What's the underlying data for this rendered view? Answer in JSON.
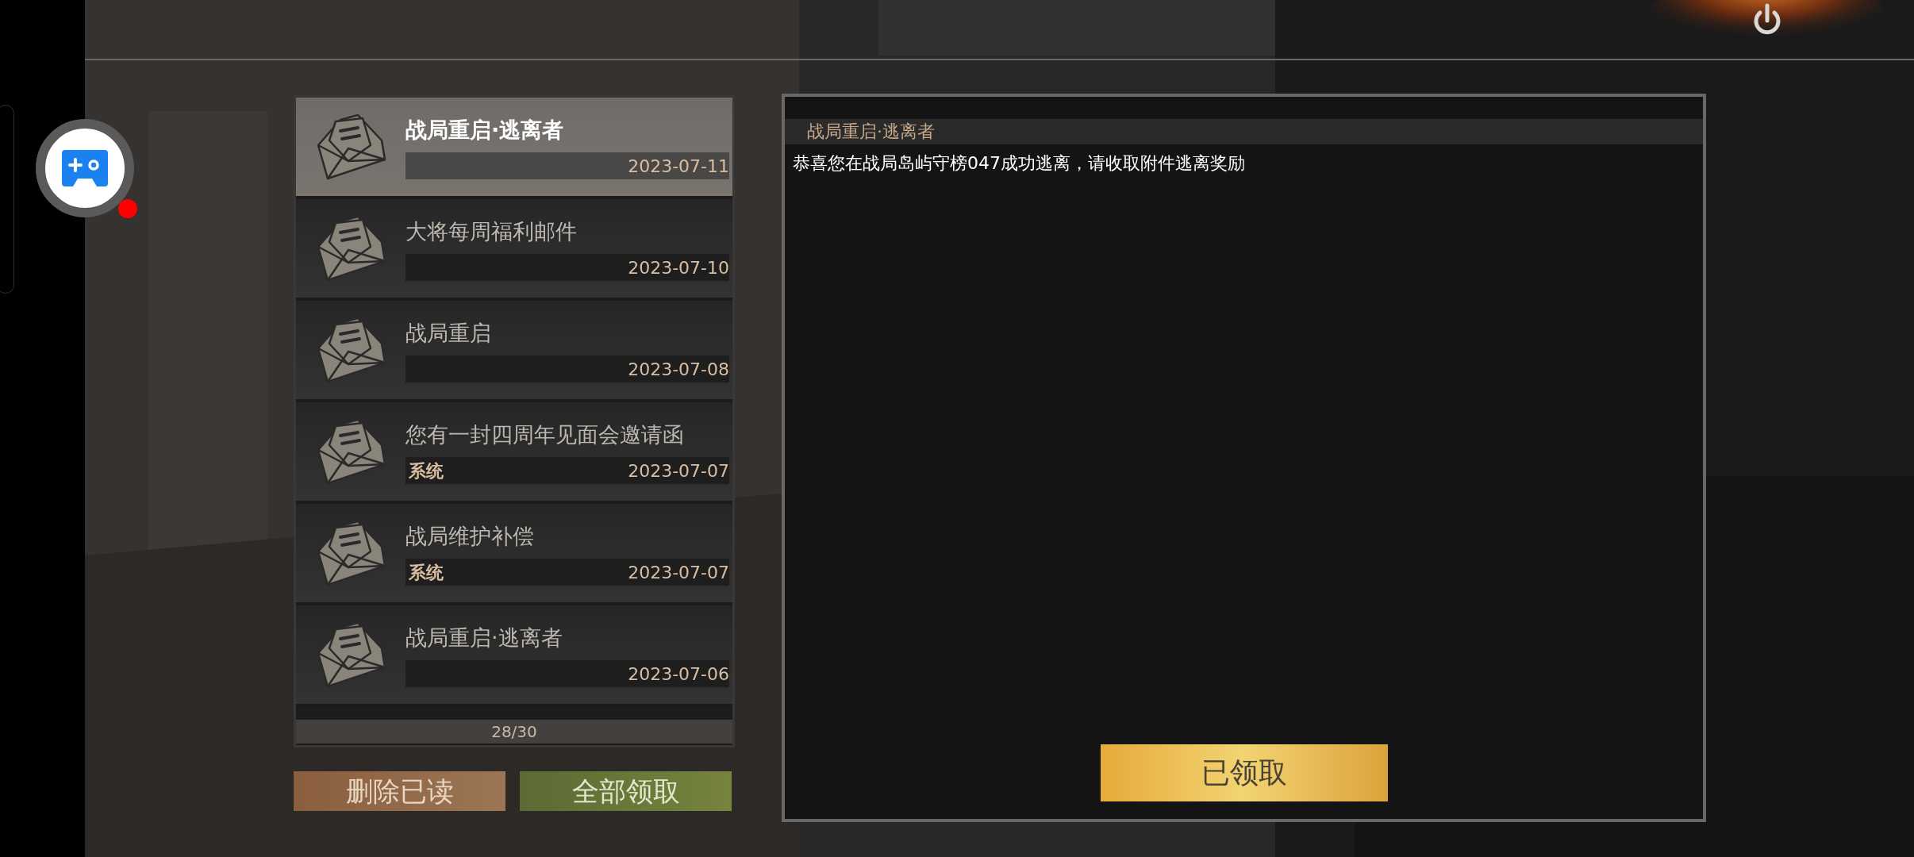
{
  "mails": [
    {
      "title": "战局重启·逃离者",
      "date": "2023-07-11",
      "selected": true
    },
    {
      "title": "大将每周福利邮件",
      "date": "2023-07-10",
      "selected": false
    },
    {
      "title": "战局重启",
      "date": "2023-07-08",
      "selected": false
    },
    {
      "title": "您有一封四周年见面会邀请函",
      "sender": "系统",
      "date": "2023-07-07",
      "selected": false
    },
    {
      "title": "战局维护补偿",
      "sender": "系统",
      "date": "2023-07-07",
      "selected": false
    },
    {
      "title": "战局重启·逃离者",
      "date": "2023-07-06",
      "selected": false
    }
  ],
  "counter": "28/30",
  "buttons": [
    {
      "label": "删除已读",
      "kind": "delete"
    },
    {
      "label": "全部领取",
      "kind": "claim"
    }
  ],
  "detail": {
    "title": "战局重启·逃离者",
    "body": "恭喜您在战局岛屿守榜047成功逃离，请收取附件逃离奖励",
    "claim_button": {
      "label": "已领取"
    }
  }
}
